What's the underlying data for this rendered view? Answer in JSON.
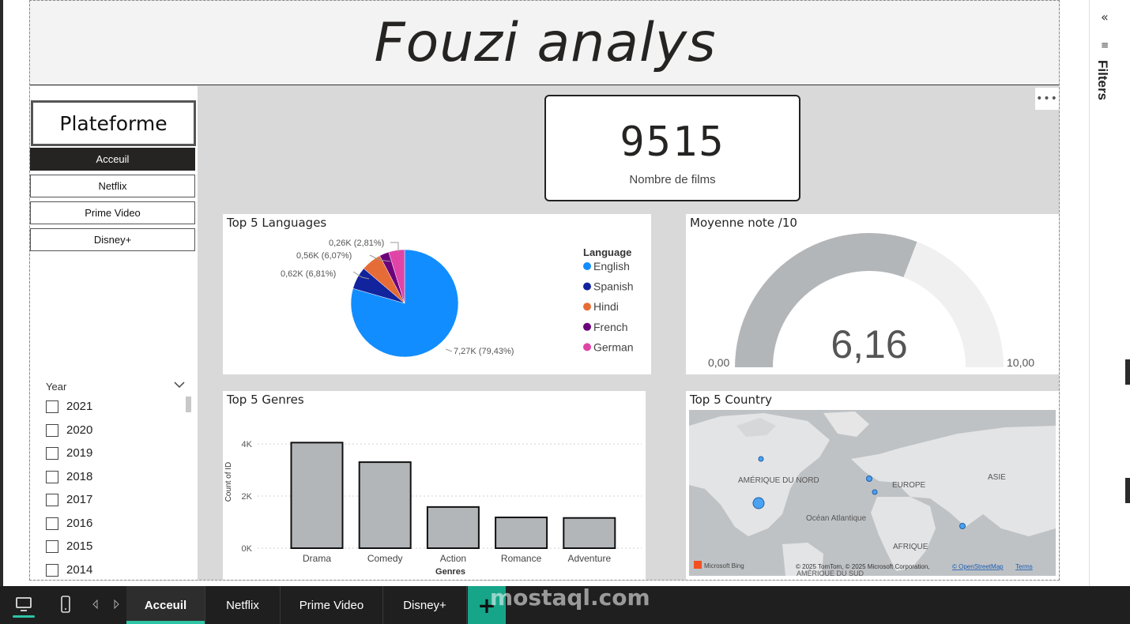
{
  "header": {
    "title": "Fouzi analys"
  },
  "nav": {
    "title": "Plateforme",
    "buttons": [
      "Acceuil",
      "Netflix",
      "Prime Video",
      "Disney+"
    ]
  },
  "kpi": {
    "value": "9515",
    "label": "Nombre de films"
  },
  "year_slicer": {
    "title": "Year",
    "items": [
      "2021",
      "2020",
      "2019",
      "2018",
      "2017",
      "2016",
      "2015",
      "2014"
    ]
  },
  "languages": {
    "title": "Top 5 Languages",
    "legend_title": "Language",
    "labels": [
      "7,27K (79,43%)",
      "0,62K (6,81%)",
      "0,56K (6,07%)",
      "0,26K (2,81%)"
    ],
    "colors": [
      "#118dff",
      "#12239e",
      "#e66c37",
      "#6b007b",
      "#e044a7"
    ]
  },
  "gauge": {
    "title": "Moyenne note /10",
    "value_label": "6,16",
    "min_label": "0,00",
    "max_label": "10,00"
  },
  "genres": {
    "title": "Top 5 Genres",
    "ylabel": "Count of ID",
    "xlabel": "Genres",
    "ticks": [
      "4K",
      "2K",
      "0K"
    ]
  },
  "country": {
    "title": "Top 5 Country",
    "labels": {
      "north_america": "AMÉRIQUE DU NORD",
      "europe": "EUROPE",
      "asia": "ASIE",
      "atlantic": "Océan Atlantique",
      "africa": "AFRIQUE",
      "south_america": "AMÉRIQUE DU SUD"
    },
    "copyright": "© 2025 TomTom, © 2025 Microsoft Corporation,",
    "osm": "© OpenStreetMap",
    "terms": "Terms",
    "bing": "Microsoft Bing"
  },
  "filters": {
    "label": "Filters",
    "collapse_icon": "double-chevron-left-icon"
  },
  "bottom_tabs": [
    "Acceuil",
    "Netflix",
    "Prime Video",
    "Disney+"
  ],
  "watermark": "mostaql.com",
  "chart_data": [
    {
      "type": "pie",
      "title": "Top 5 Languages",
      "legend_title": "Language",
      "categories": [
        "English",
        "Spanish",
        "Hindi",
        "French",
        "German"
      ],
      "values": [
        7.27,
        0.62,
        0.56,
        0.26,
        0.44
      ],
      "unit": "K",
      "percent": [
        79.43,
        6.81,
        6.07,
        2.81,
        null
      ],
      "legend_placement": "right"
    },
    {
      "type": "bar",
      "title": "Top 5 Genres",
      "xlabel": "Genres",
      "ylabel": "Count of ID",
      "categories": [
        "Drama",
        "Comedy",
        "Action",
        "Romance",
        "Adventure"
      ],
      "values": [
        4050,
        3300,
        1580,
        1180,
        1160
      ],
      "ylim": [
        0,
        4000
      ],
      "yticks": [
        0,
        2000,
        4000
      ]
    },
    {
      "type": "gauge",
      "title": "Moyenne note /10",
      "value": 6.16,
      "min": 0,
      "max": 10
    }
  ]
}
